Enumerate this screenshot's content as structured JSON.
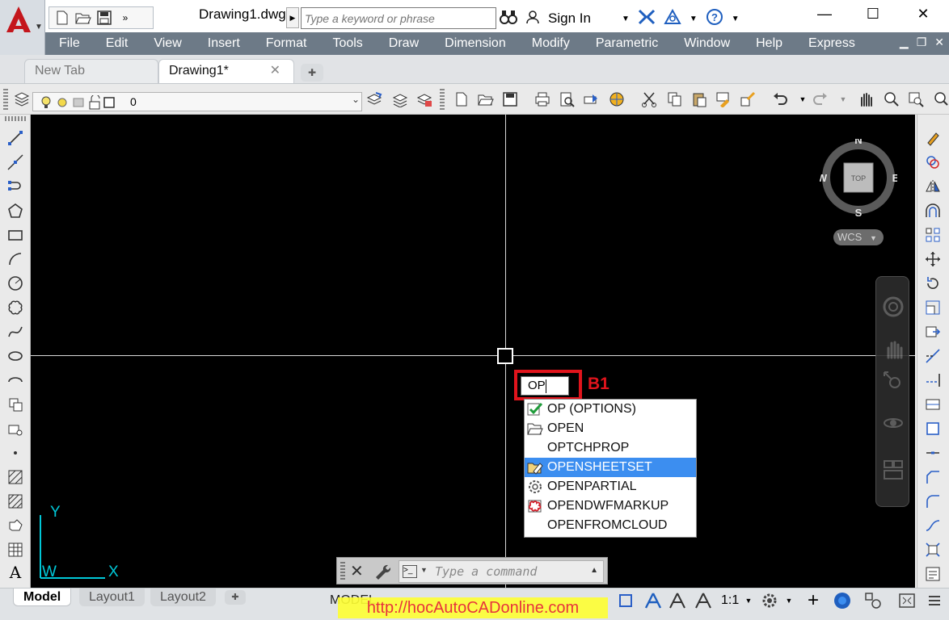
{
  "titlebar": {
    "document_title": "Drawing1.dwg",
    "search_placeholder": "Type a keyword or phrase",
    "sign_in": "Sign In",
    "minimize": "—",
    "maximize": "☐",
    "close": "✕"
  },
  "menu": {
    "items": [
      "File",
      "Edit",
      "View",
      "Insert",
      "Format",
      "Tools",
      "Draw",
      "Dimension",
      "Modify",
      "Parametric",
      "Window",
      "Help",
      "Express"
    ]
  },
  "tabs": {
    "new_tab": "New Tab",
    "drawing_tab": "Drawing1*",
    "close_glyph": "✕",
    "add_glyph": "✚"
  },
  "layer": {
    "current": "0"
  },
  "viewcube": {
    "north": "N",
    "south": "S",
    "east": "E",
    "west": "W",
    "face": "TOP",
    "wcs": "WCS"
  },
  "ucs": {
    "x": "X",
    "y": "Y",
    "w": "W"
  },
  "dynamic_input": {
    "value": "OP",
    "annotation_label": "B1"
  },
  "autocomplete": {
    "items": [
      {
        "label": "OP (OPTIONS)",
        "icon": "checkmark-options-icon",
        "selected": false
      },
      {
        "label": "OPEN",
        "icon": "folder-open-icon",
        "selected": false
      },
      {
        "label": "OPTCHPROP",
        "icon": "",
        "selected": false
      },
      {
        "label": "OPENSHEETSET",
        "icon": "sheetset-open-icon",
        "selected": true
      },
      {
        "label": "OPENPARTIAL",
        "icon": "gear-icon",
        "selected": false
      },
      {
        "label": "OPENDWFMARKUP",
        "icon": "markup-icon",
        "selected": false
      },
      {
        "label": "OPENFROMCLOUD",
        "icon": "",
        "selected": false
      }
    ],
    "selected_color": "#3c8ef0"
  },
  "command_line": {
    "placeholder": "Type a command"
  },
  "status_bar": {
    "layout_tabs": [
      "Model",
      "Layout1",
      "Layout2"
    ],
    "model_label": "MODEL",
    "scale": "1:1",
    "watermark": "http://hocAutoCADonline.com"
  },
  "colors": {
    "menubar": "#6d7a87",
    "canvas": "#000000",
    "annotation_red": "#e0141c",
    "ucs_cyan": "#00c8d8"
  }
}
